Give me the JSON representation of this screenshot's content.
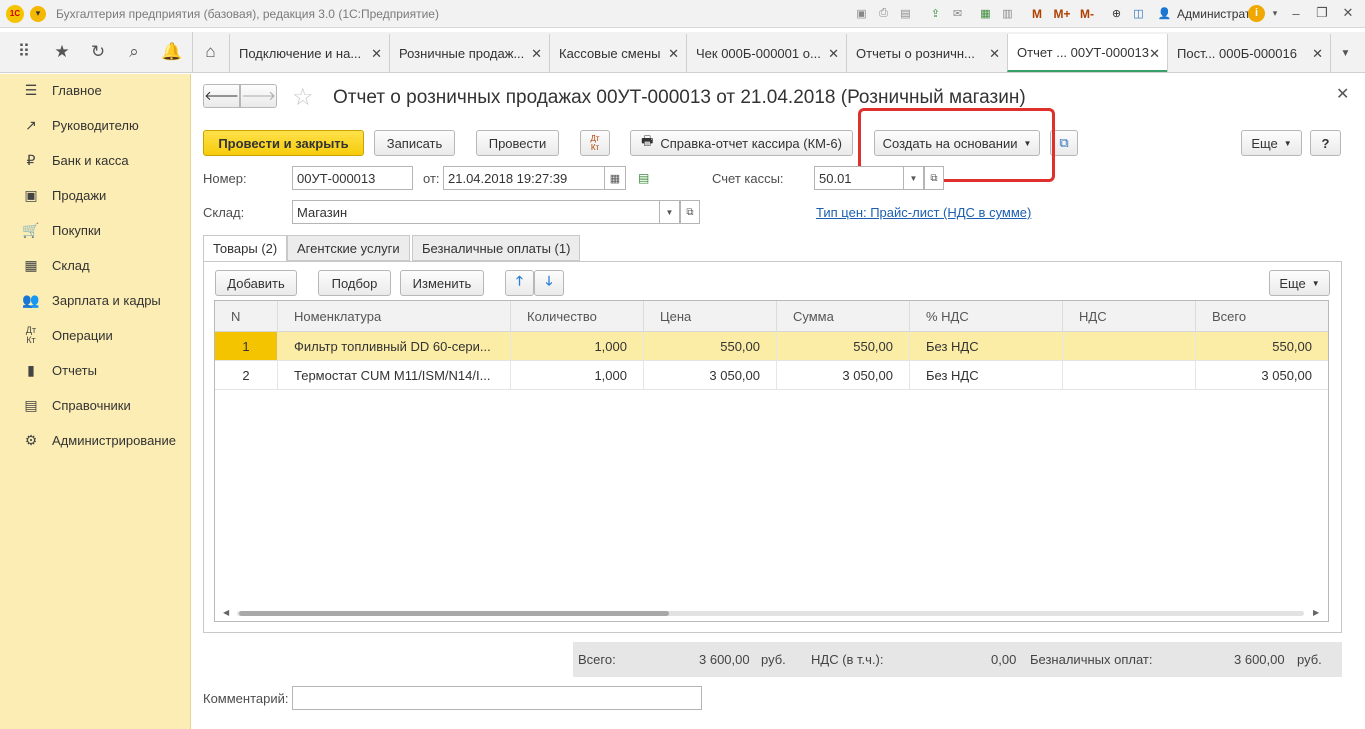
{
  "app": {
    "title": "Бухгалтерия предприятия (базовая), редакция 3.0  (1С:Предприятие)",
    "logo_text": "1С",
    "user": "Администратор",
    "m_labels": [
      "M",
      "M+",
      "M-"
    ]
  },
  "tabs": [
    {
      "label": "Подключение и на..."
    },
    {
      "label": "Розничные продаж..."
    },
    {
      "label": "Кассовые смены"
    },
    {
      "label": "Чек 000Б-000001 о..."
    },
    {
      "label": "Отчеты о розничн..."
    },
    {
      "label": "Отчет ... 00УТ-000013"
    },
    {
      "label": "Пост...      000Б-000016"
    }
  ],
  "sidebar": {
    "items": [
      {
        "label": "Главное",
        "icon": "menu-lines-icon"
      },
      {
        "label": "Руководителю",
        "icon": "trend-icon"
      },
      {
        "label": "Банк и касса",
        "icon": "coin-icon"
      },
      {
        "label": "Продажи",
        "icon": "bag-icon"
      },
      {
        "label": "Покупки",
        "icon": "cart-icon"
      },
      {
        "label": "Склад",
        "icon": "grid-icon"
      },
      {
        "label": "Зарплата и кадры",
        "icon": "people-icon"
      },
      {
        "label": "Операции",
        "icon": "dt-kt-icon"
      },
      {
        "label": "Отчеты",
        "icon": "bar-chart-icon"
      },
      {
        "label": "Справочники",
        "icon": "book-icon"
      },
      {
        "label": "Администрирование",
        "icon": "gear-icon"
      }
    ]
  },
  "form": {
    "title": "Отчет о розничных продажах 00УТ-000013 от 21.04.2018 (Розничный магазин)",
    "buttons": {
      "post_close": "Провести и закрыть",
      "save": "Записать",
      "post": "Провести",
      "dtkt": "Дт Кт",
      "km6": "Справка-отчет кассира (КМ-6)",
      "create_basis": "Создать на основании",
      "more": "Еще",
      "help": "?"
    },
    "fields": {
      "number_label": "Номер:",
      "number_value": "00УТ-000013",
      "date_label": "от:",
      "date_value": "21.04.2018 19:27:39",
      "account_label": "Счет кассы:",
      "account_value": "50.01",
      "warehouse_label": "Склад:",
      "warehouse_value": "Магазин",
      "price_type_link": "Тип цен: Прайс-лист (НДС в сумме)"
    },
    "inner_tabs": [
      {
        "label": "Товары (2)"
      },
      {
        "label": "Агентские услуги"
      },
      {
        "label": "Безналичные оплаты (1)"
      }
    ],
    "table_toolbar": {
      "add": "Добавить",
      "pick": "Подбор",
      "change": "Изменить",
      "more": "Еще"
    },
    "table": {
      "headers": [
        "N",
        "Номенклатура",
        "Количество",
        "Цена",
        "Сумма",
        "% НДС",
        "НДС",
        "Всего"
      ],
      "rows": [
        [
          "1",
          "Фильтр топливный DD 60-сери...",
          "1,000",
          "550,00",
          "550,00",
          "Без НДС",
          "",
          "550,00"
        ],
        [
          "2",
          "Термостат CUM M11/ISM/N14/I...",
          "1,000",
          "3 050,00",
          "3 050,00",
          "Без НДС",
          "",
          "3 050,00"
        ]
      ],
      "selected_row": 0
    },
    "totals": {
      "total_label": "Всего:",
      "total_value": "3 600,00",
      "currency": "руб.",
      "vat_label": "НДС (в т.ч.):",
      "vat_value": "0,00",
      "cashless_label": "Безналичных оплат:",
      "cashless_value": "3 600,00",
      "currency2": "руб."
    },
    "comment_label": "Комментарий:",
    "comment_value": ""
  },
  "colors": {
    "sidebar_bg": "#fbedb3",
    "primary_button": "#f6cc0a",
    "selected_row": "#fbeda6",
    "highlight_box": "#e0302c",
    "link": "#1c5fb0",
    "active_tab_underline": "#3aa06a"
  }
}
